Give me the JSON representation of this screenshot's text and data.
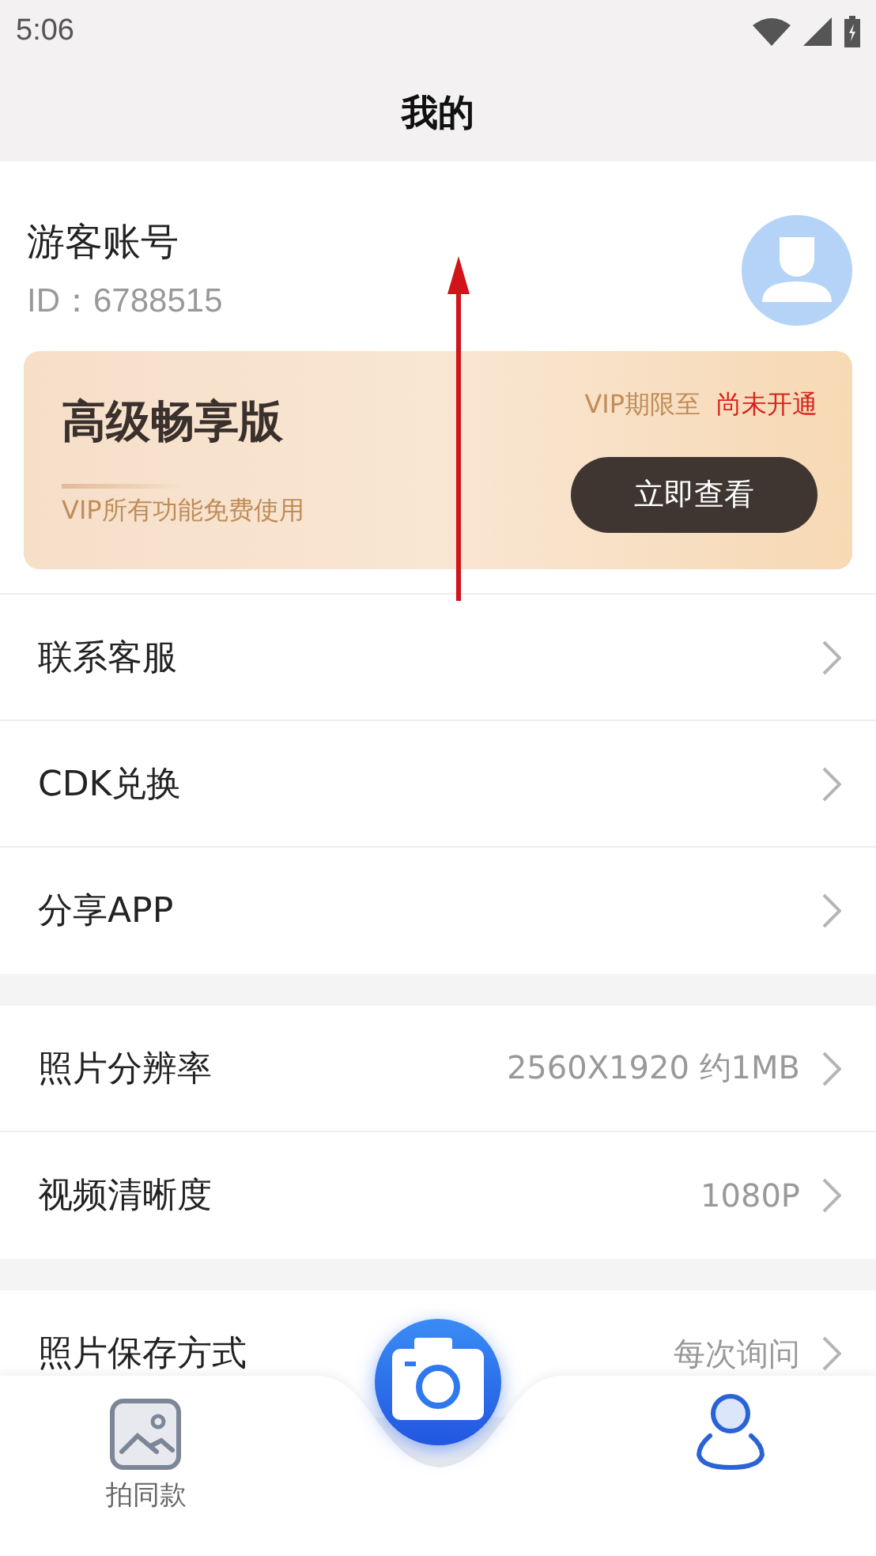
{
  "status_bar": {
    "time": "5:06"
  },
  "header": {
    "title": "我的"
  },
  "profile": {
    "name": "游客账号",
    "id": "ID：6788515"
  },
  "vip_card": {
    "title": "高级畅享版",
    "subtitle": "VIP所有功能免费使用",
    "expiry_label": "VIP期限至",
    "expiry_value": "尚未开通",
    "button": "立即查看"
  },
  "sections": [
    [
      {
        "label": "联系客服"
      },
      {
        "label": "CDK兑换"
      },
      {
        "label": "分享APP"
      }
    ],
    [
      {
        "label": "照片分辨率",
        "value": "2560X1920 约1MB"
      },
      {
        "label": "视频清晰度",
        "value": "1080P"
      }
    ],
    [
      {
        "label": "照片保存方式",
        "value": "每次询问"
      }
    ]
  ],
  "bottom_nav": [
    {
      "kind": "gallery",
      "label": "拍同款",
      "selected": false
    },
    {
      "kind": "camera",
      "selected": false
    },
    {
      "kind": "profile",
      "selected": true
    }
  ],
  "annotation": {
    "kind": "arrow"
  }
}
